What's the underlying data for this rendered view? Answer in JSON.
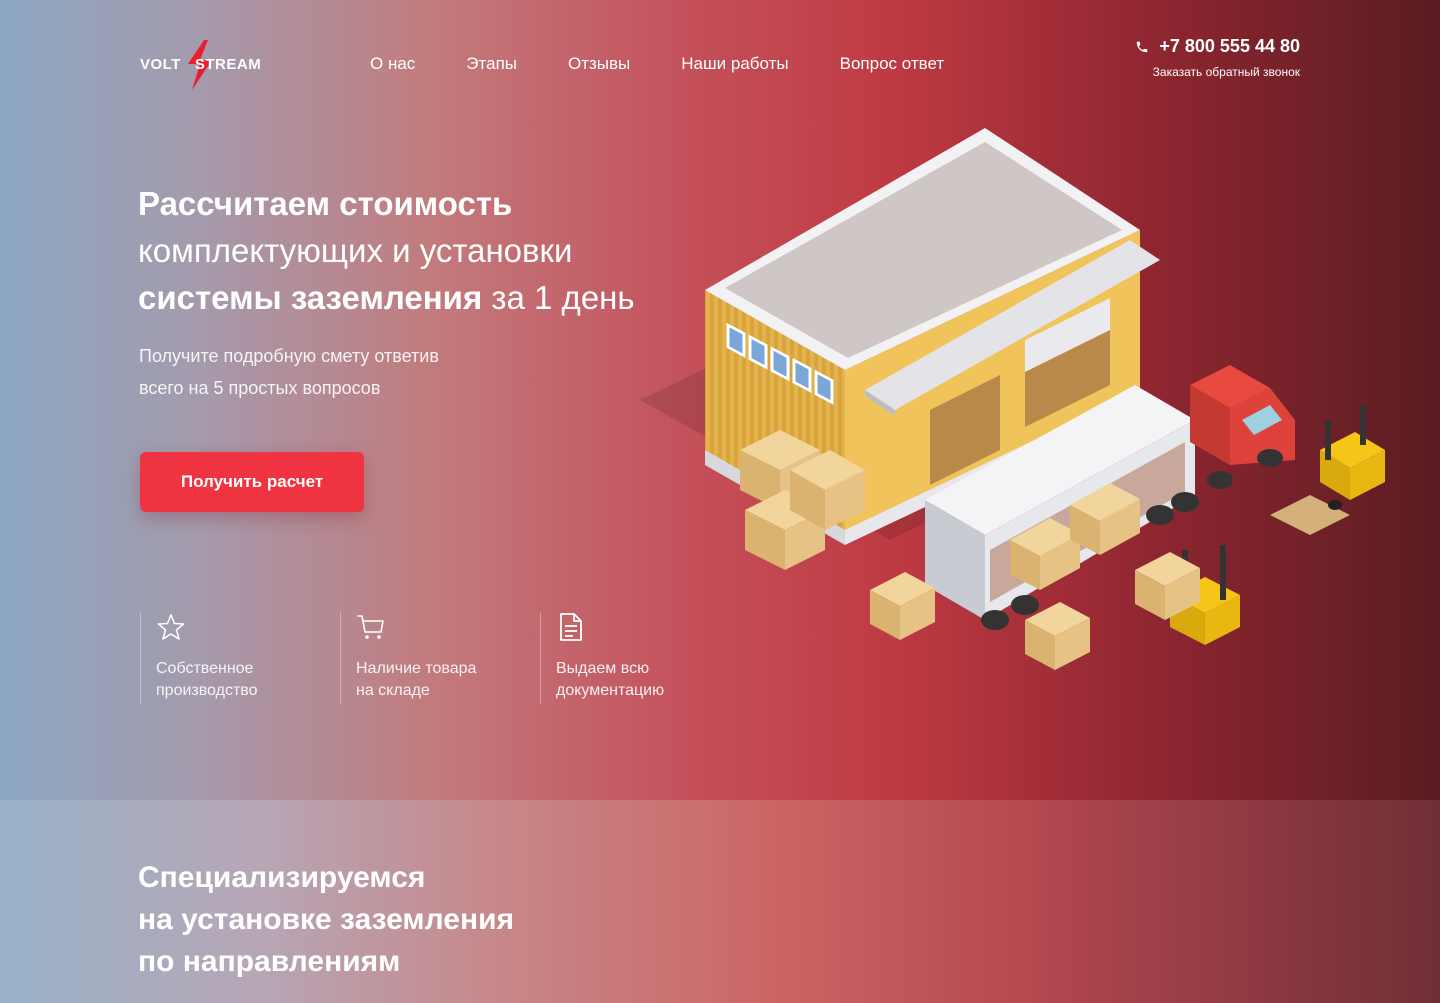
{
  "brand": {
    "logo_part1": "VOLT",
    "logo_part2": "STREAM"
  },
  "nav": {
    "items": [
      "О нас",
      "Этапы",
      "Отзывы",
      "Наши работы",
      "Вопрос ответ"
    ]
  },
  "contact": {
    "phone": "+7 800 555 44 80",
    "callback": "Заказать обратный звонок",
    "icon": "phone-icon"
  },
  "hero": {
    "headline_1_bold": "Рассчитаем стоимость",
    "headline_2": "комплектующих и установки",
    "headline_3_bold": "системы заземления",
    "headline_3_rest": " за 1 день",
    "subtitle_1": "Получите подробную смету ответив",
    "subtitle_2": "всего на 5 простых вопросов",
    "cta_label": "Получить расчет"
  },
  "features": [
    {
      "icon": "star-icon",
      "text": "Собственное\nпроизводство"
    },
    {
      "icon": "cart-icon",
      "text": "Наличие товара\nна складе"
    },
    {
      "icon": "document-icon",
      "text": "Выдаем всю\nдокументацию"
    }
  ],
  "section": {
    "title": "Специализируемся\nна установке заземления\nпо направлениям"
  },
  "colors": {
    "accent": "#ef3340",
    "primary_red": "#bf3a43",
    "steel_blue": "#8ca7c2"
  }
}
